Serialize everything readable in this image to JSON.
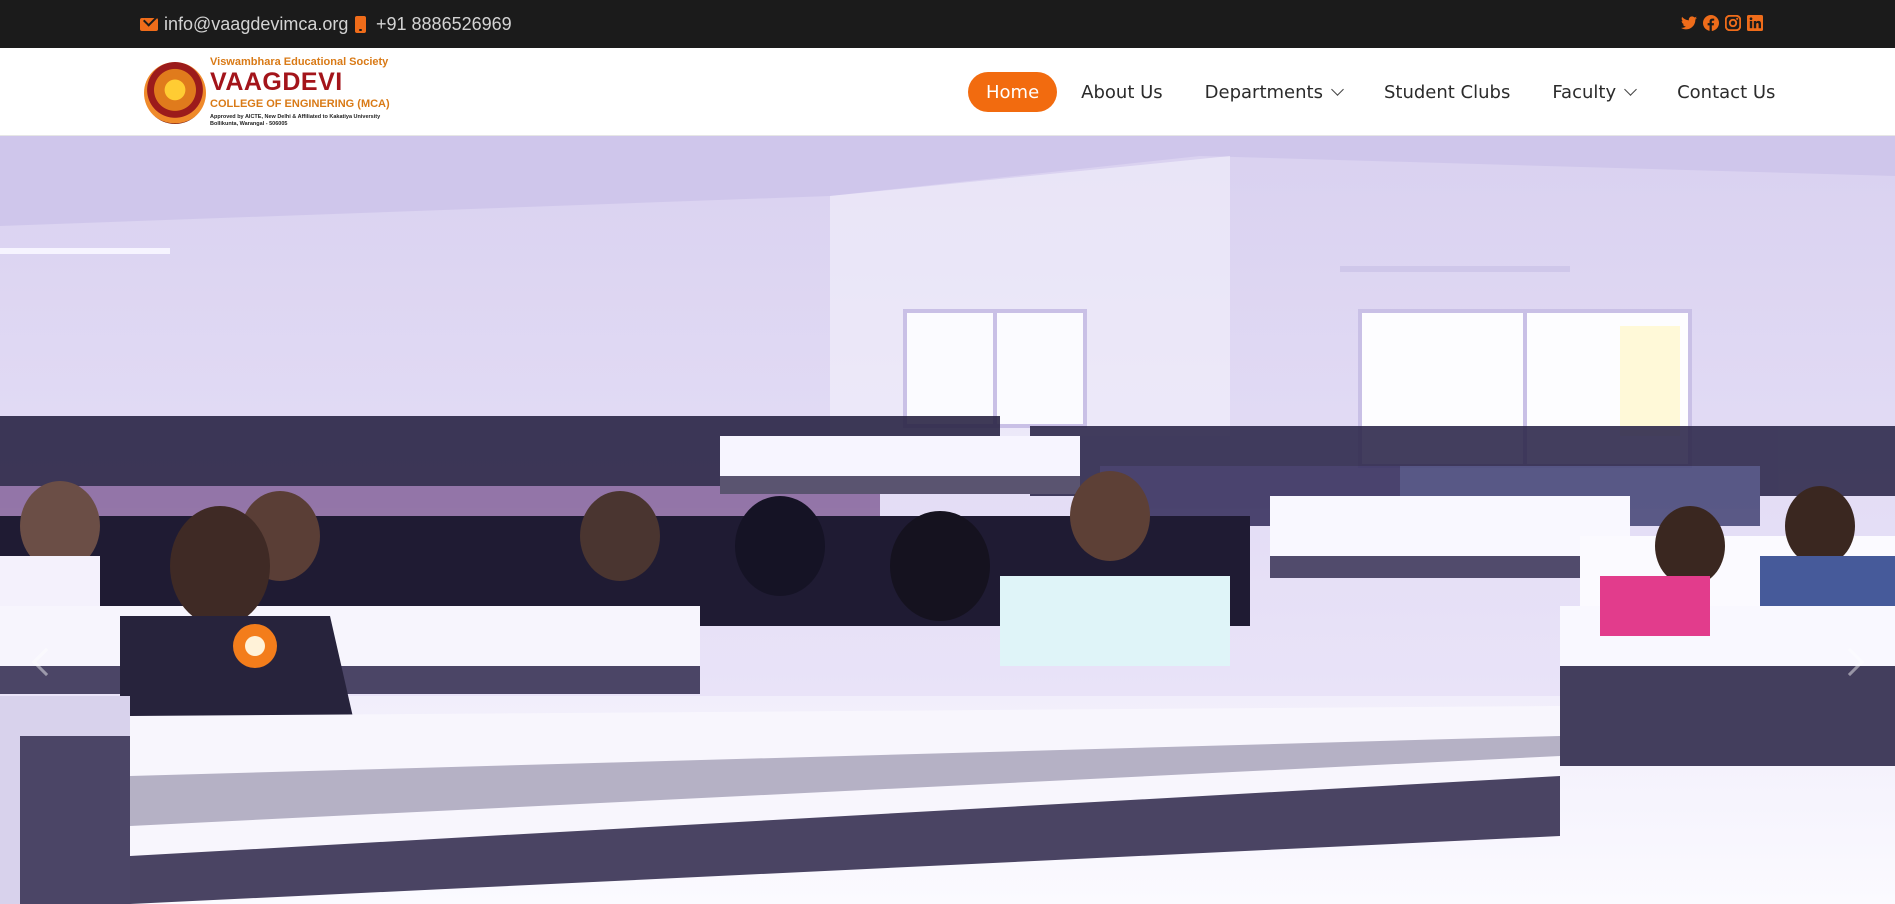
{
  "topbar": {
    "email": "info@vaagdevimca.org",
    "phone": "+91 8886526969",
    "icons": [
      "mail-icon",
      "phone-icon"
    ],
    "social": [
      "twitter-icon",
      "facebook-icon",
      "instagram-icon",
      "linkedin-icon"
    ]
  },
  "logo": {
    "society": "Viswambhara Educational Society",
    "name": "VAAGDEVI",
    "college": "COLLEGE OF ENGINERING (MCA)",
    "approval_line1": "Approved by AICTE, New Delhi & Affiliated to Kakatiya University",
    "approval_line2": "Bollikunta, Warangal - 506005"
  },
  "nav": {
    "items": [
      {
        "label": "Home",
        "active": true
      },
      {
        "label": "About Us"
      },
      {
        "label": "Departments",
        "dropdown": true
      },
      {
        "label": "Student Clubs"
      },
      {
        "label": "Faculty",
        "dropdown": true
      },
      {
        "label": "Contact Us"
      }
    ]
  },
  "hero": {
    "description_icon": "classroom-photo",
    "prev_icon": "chevron-left-icon",
    "next_icon": "chevron-right-icon"
  },
  "colors": {
    "accent": "#f26b0f",
    "topbar_bg": "#1b1b1b",
    "brand_red": "#a3141a"
  }
}
